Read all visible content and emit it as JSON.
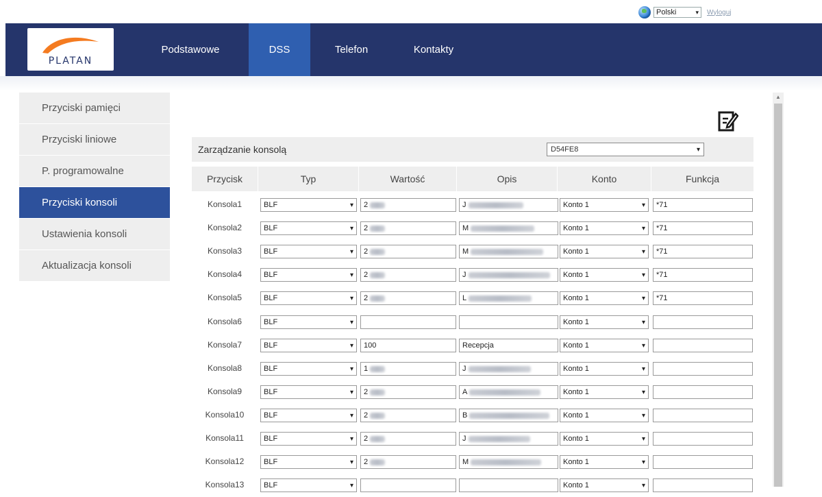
{
  "language": {
    "selected": "Polski",
    "logout_label": "Wyloguj"
  },
  "logo": {
    "text": "PLATAN"
  },
  "nav": {
    "items": [
      {
        "label": "Podstawowe",
        "active": false
      },
      {
        "label": "DSS",
        "active": true
      },
      {
        "label": "Telefon",
        "active": false
      },
      {
        "label": "Kontakty",
        "active": false
      }
    ]
  },
  "sidebar": {
    "items": [
      {
        "label": "Przyciski pamięci",
        "active": false
      },
      {
        "label": "Przyciski liniowe",
        "active": false
      },
      {
        "label": "P. programowalne",
        "active": false
      },
      {
        "label": "Przyciski konsoli",
        "active": true
      },
      {
        "label": "Ustawienia konsoli",
        "active": false
      },
      {
        "label": "Aktualizacja konsoli",
        "active": false
      }
    ]
  },
  "management": {
    "label": "Zarządzanie konsolą",
    "device": "D54FE8"
  },
  "table": {
    "headers": [
      "Przycisk",
      "Typ",
      "Wartość",
      "Opis",
      "Konto",
      "Funkcja"
    ],
    "rows": [
      {
        "button": "Konsola1",
        "type": "BLF",
        "value": "2",
        "value_blurred": true,
        "desc": "J",
        "desc_blurred": true,
        "account": "Konto 1",
        "function": "*71"
      },
      {
        "button": "Konsola2",
        "type": "BLF",
        "value": "2",
        "value_blurred": true,
        "desc": "M",
        "desc_blurred": true,
        "account": "Konto 1",
        "function": "*71"
      },
      {
        "button": "Konsola3",
        "type": "BLF",
        "value": "2",
        "value_blurred": true,
        "desc": "M",
        "desc_blurred": true,
        "account": "Konto 1",
        "function": "*71"
      },
      {
        "button": "Konsola4",
        "type": "BLF",
        "value": "2",
        "value_blurred": true,
        "desc": "J",
        "desc_blurred": true,
        "account": "Konto 1",
        "function": "*71"
      },
      {
        "button": "Konsola5",
        "type": "BLF",
        "value": "2",
        "value_blurred": true,
        "desc": "L",
        "desc_blurred": true,
        "account": "Konto 1",
        "function": "*71"
      },
      {
        "button": "Konsola6",
        "type": "BLF",
        "value": "",
        "value_blurred": false,
        "desc": "",
        "desc_blurred": false,
        "account": "Konto 1",
        "function": ""
      },
      {
        "button": "Konsola7",
        "type": "BLF",
        "value": "100",
        "value_blurred": false,
        "desc": "Recepcja",
        "desc_blurred": false,
        "account": "Konto 1",
        "function": ""
      },
      {
        "button": "Konsola8",
        "type": "BLF",
        "value": "1",
        "value_blurred": true,
        "desc": "J",
        "desc_blurred": true,
        "account": "Konto 1",
        "function": ""
      },
      {
        "button": "Konsola9",
        "type": "BLF",
        "value": "2",
        "value_blurred": true,
        "desc": "A",
        "desc_blurred": true,
        "account": "Konto 1",
        "function": ""
      },
      {
        "button": "Konsola10",
        "type": "BLF",
        "value": "2",
        "value_blurred": true,
        "desc": "B",
        "desc_blurred": true,
        "account": "Konto 1",
        "function": ""
      },
      {
        "button": "Konsola11",
        "type": "BLF",
        "value": "2",
        "value_blurred": true,
        "desc": "J",
        "desc_blurred": true,
        "account": "Konto 1",
        "function": ""
      },
      {
        "button": "Konsola12",
        "type": "BLF",
        "value": "2",
        "value_blurred": true,
        "desc": "M",
        "desc_blurred": true,
        "account": "Konto 1",
        "function": ""
      },
      {
        "button": "Konsola13",
        "type": "BLF",
        "value": "",
        "value_blurred": false,
        "desc": "",
        "desc_blurred": false,
        "account": "Konto 1",
        "function": ""
      }
    ]
  },
  "colors": {
    "navbar": "#25356b",
    "nav_active": "#2f5fb0",
    "sidebar_active": "#2d519c",
    "logo_orange": "#f47b20"
  },
  "icons": {
    "language": "globe-icon",
    "edit": "edit-icon",
    "dropdown": "chevron-down-icon"
  }
}
